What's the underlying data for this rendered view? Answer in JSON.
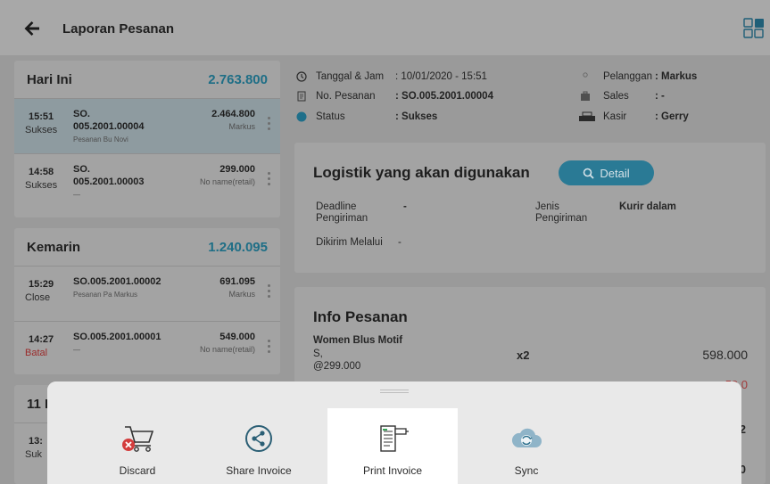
{
  "header": {
    "title": "Laporan Pesanan"
  },
  "groups": [
    {
      "label": "Hari Ini",
      "total": "2.763.800",
      "orders": [
        {
          "time": "15:51",
          "status": "Sukses",
          "so_line1": "SO.",
          "so_line2": "005.2001.00004",
          "note": "Pesanan Bu Novi",
          "amount": "2.464.800",
          "customer": "Markus"
        },
        {
          "time": "14:58",
          "status": "Sukses",
          "so_line1": "SO.",
          "so_line2": "005.2001.00003",
          "note": "—",
          "amount": "299.000",
          "customer": "No name(retail)"
        }
      ]
    },
    {
      "label": "Kemarin",
      "total": "1.240.095",
      "orders": [
        {
          "time": "15:29",
          "status": "Close",
          "so_line1": "SO.005.2001.00002",
          "so_line2": "",
          "note": "Pesanan Pa Markus",
          "amount": "691.095",
          "customer": "Markus"
        },
        {
          "time": "14:27",
          "status": "Batal",
          "so_line1": "SO.005.2001.00001",
          "so_line2": "",
          "note": "—",
          "amount": "549.000",
          "customer": "No name(retail)"
        }
      ]
    },
    {
      "label": "11 D",
      "total": "",
      "orders": [
        {
          "time": "13:",
          "status": "Suk"
        }
      ]
    }
  ],
  "order_info": {
    "datetime_label": "Tanggal & Jam",
    "datetime_value": ": 10/01/2020 - 15:51",
    "number_label": "No. Pesanan",
    "number_value": ": SO.005.2001.00004",
    "status_label": "Status",
    "status_value": ": Sukses",
    "customer_label": "Pelanggan",
    "customer_value": ": Markus",
    "sales_label": "Sales",
    "sales_value": ": -",
    "cashier_label": "Kasir",
    "cashier_value": ": Gerry"
  },
  "logistics": {
    "title": "Logistik yang akan digunakan",
    "detail_label": "Detail",
    "deadline_label_1": "Deadline",
    "deadline_label_2": "Pengiriman",
    "deadline_value": "-",
    "type_label_1": "Jenis",
    "type_label_2": "Pengiriman",
    "type_value": "Kurir dalam",
    "via_label": "Dikirim Melalui",
    "via_value": "-"
  },
  "order_detail": {
    "title": "Info Pesanan",
    "item_name": "Women Blus Motif",
    "item_variant": "S,",
    "item_price": "@299.000",
    "item_qty": "x2",
    "item_total": "598.000",
    "partial_red": "59.0",
    "partial_2": "2",
    "partial_0": "0"
  },
  "sheet": {
    "actions": [
      {
        "label": "Discard",
        "icon": "cart-remove-icon"
      },
      {
        "label": "Share Invoice",
        "icon": "share-icon"
      },
      {
        "label": "Print Invoice",
        "icon": "printer-icon"
      },
      {
        "label": "Sync",
        "icon": "cloud-sync-icon"
      }
    ]
  },
  "colors": {
    "accent": "#1e6e86",
    "button": "#2a7a95",
    "danger": "#c0392b"
  }
}
